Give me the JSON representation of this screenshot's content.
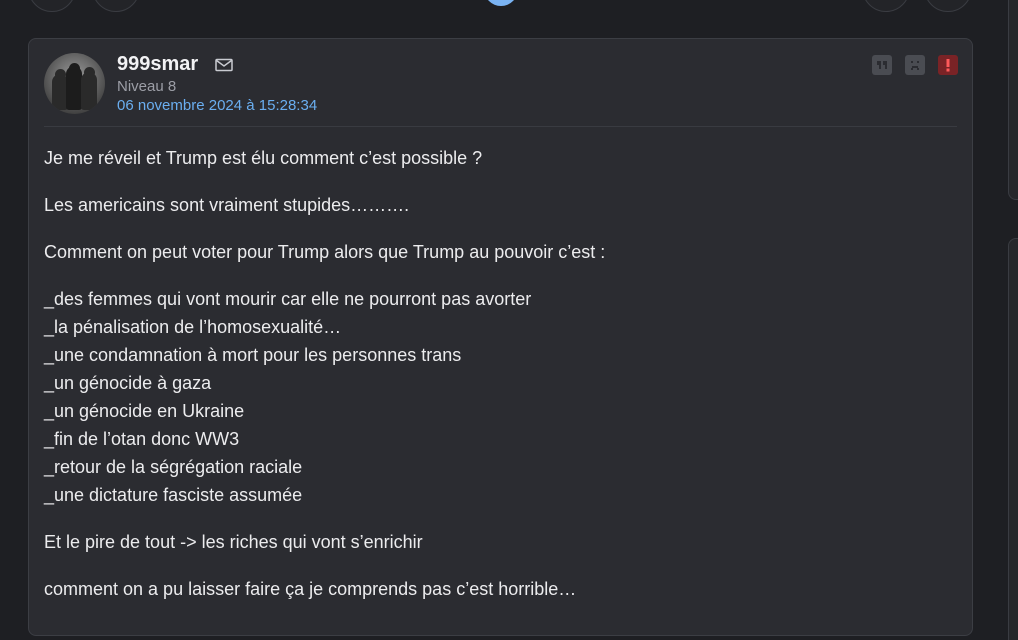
{
  "post": {
    "author": "999smar",
    "level": "Niveau 8",
    "date": "06 novembre 2024 à 15:28:34",
    "icons": {
      "mail": "mail-icon",
      "quote": "quote-icon",
      "sad": "sad-face-icon",
      "report": "report-alert-icon"
    },
    "paragraphs": [
      "Je me réveil et Trump est élu comment c’est possible ?",
      "Les americains sont vraiment stupides……….",
      "Comment on peut voter pour Trump alors que Trump au pouvoir c’est :"
    ],
    "list_lines": [
      "_des femmes qui vont mourir car elle ne pourront pas avorter",
      "_la pénalisation de l’homosexualité…",
      "_une condamnation à mort pour les personnes trans",
      "_un génocide à gaza",
      "_un génocide en Ukraine",
      "_fin de l’otan donc WW3",
      "_retour de la ségrégation raciale",
      "_une dictature fasciste assumée"
    ],
    "closing": [
      "Et le pire de tout -> les riches qui vont s’enrichir",
      "comment on a pu laisser faire ça je comprends pas c’est horrible…"
    ]
  },
  "colors": {
    "background": "#1e1f23",
    "card": "#2b2c31",
    "date_link": "#6aaef0",
    "accent_dot": "#7ab3f3",
    "report": "#7a2326"
  }
}
